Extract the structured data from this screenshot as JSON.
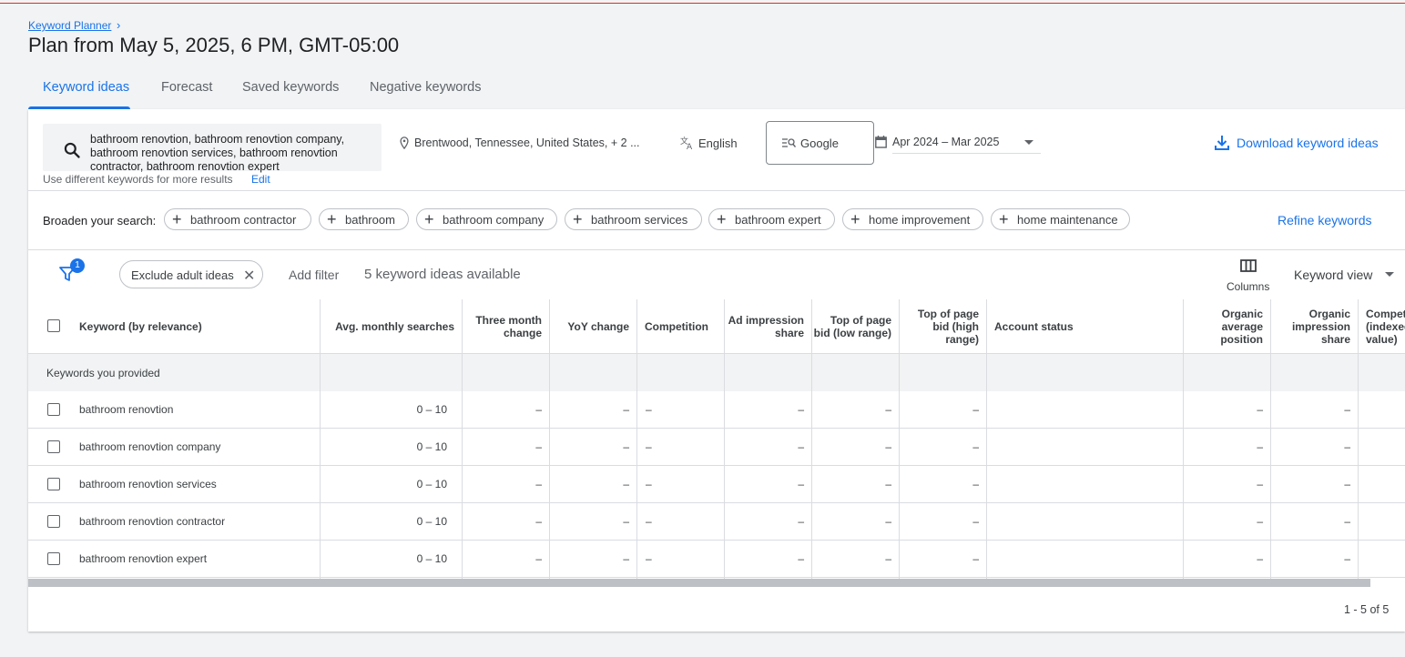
{
  "breadcrumb": {
    "label": "Keyword Planner",
    "chevron": "›"
  },
  "page_title": "Plan from May 5, 2025, 6 PM, GMT-05:00",
  "tabs": [
    {
      "label": "Keyword ideas",
      "active": true
    },
    {
      "label": "Forecast",
      "active": false
    },
    {
      "label": "Saved keywords",
      "active": false
    },
    {
      "label": "Negative keywords",
      "active": false
    }
  ],
  "search": {
    "icon": "search-icon",
    "value": "bathroom renovtion, bathroom renovtion company, bathroom renovtion services, bathroom renovtion contractor, bathroom renovtion expert",
    "hint": "Use different keywords for more results",
    "edit_label": "Edit"
  },
  "location": {
    "icon": "location-pin-icon",
    "label": "Brentwood, Tennessee, United States, + 2 ..."
  },
  "language": {
    "icon": "translate-icon",
    "label": "English"
  },
  "network": {
    "icon": "search-network-icon",
    "label": "Google"
  },
  "date_range": {
    "icon": "calendar-icon",
    "label": "Apr 2024 – Mar 2025"
  },
  "download": {
    "icon": "download-icon",
    "label": "Download keyword ideas"
  },
  "broaden": {
    "label": "Broaden your search:",
    "chips": [
      "bathroom contractor",
      "bathroom",
      "bathroom company",
      "bathroom services",
      "bathroom expert",
      "home improvement",
      "home maintenance"
    ],
    "refine_label": "Refine keywords"
  },
  "filter_bar": {
    "filter_icon": "filter-icon",
    "badge_count": "1",
    "exclude_chip": "Exclude adult ideas",
    "add_filter": "Add filter",
    "count_text": "5 keyword ideas available",
    "columns_label": "Columns",
    "view_label": "Keyword view"
  },
  "table": {
    "headers": {
      "keyword": "Keyword (by relevance)",
      "avg": "Avg. monthly searches",
      "three_month": "Three month change",
      "yoy": "YoY change",
      "competition": "Competition",
      "ad_impr": "Ad impression share",
      "bid_low": "Top of page bid (low range)",
      "bid_high": "Top of page bid (high range)",
      "account_status": "Account status",
      "organic_pos": "Organic average position",
      "organic_impr": "Organic impression share",
      "competition_idx": "Competition (indexed value)"
    },
    "group_label": "Keywords you provided",
    "rows": [
      {
        "keyword": "bathroom renovtion",
        "avg": "0 – 10",
        "three_month": "–",
        "yoy": "–",
        "competition": "–",
        "ad_impr": "–",
        "bid_low": "–",
        "bid_high": "–",
        "account_status": "",
        "organic_pos": "–",
        "organic_impr": "–"
      },
      {
        "keyword": "bathroom renovtion company",
        "avg": "0 – 10",
        "three_month": "–",
        "yoy": "–",
        "competition": "–",
        "ad_impr": "–",
        "bid_low": "–",
        "bid_high": "–",
        "account_status": "",
        "organic_pos": "–",
        "organic_impr": "–"
      },
      {
        "keyword": "bathroom renovtion services",
        "avg": "0 – 10",
        "three_month": "–",
        "yoy": "–",
        "competition": "–",
        "ad_impr": "–",
        "bid_low": "–",
        "bid_high": "–",
        "account_status": "",
        "organic_pos": "–",
        "organic_impr": "–"
      },
      {
        "keyword": "bathroom renovtion contractor",
        "avg": "0 – 10",
        "three_month": "–",
        "yoy": "–",
        "competition": "–",
        "ad_impr": "–",
        "bid_low": "–",
        "bid_high": "–",
        "account_status": "",
        "organic_pos": "–",
        "organic_impr": "–"
      },
      {
        "keyword": "bathroom renovtion expert",
        "avg": "0 – 10",
        "three_month": "–",
        "yoy": "–",
        "competition": "–",
        "ad_impr": "–",
        "bid_low": "–",
        "bid_high": "–",
        "account_status": "",
        "organic_pos": "–",
        "organic_impr": "–"
      }
    ],
    "pagination": "1 - 5 of 5"
  },
  "colors": {
    "accent": "#1a73e8",
    "badge": "#1a73e8",
    "border": "#dadce0",
    "top_line": "#d93025"
  }
}
